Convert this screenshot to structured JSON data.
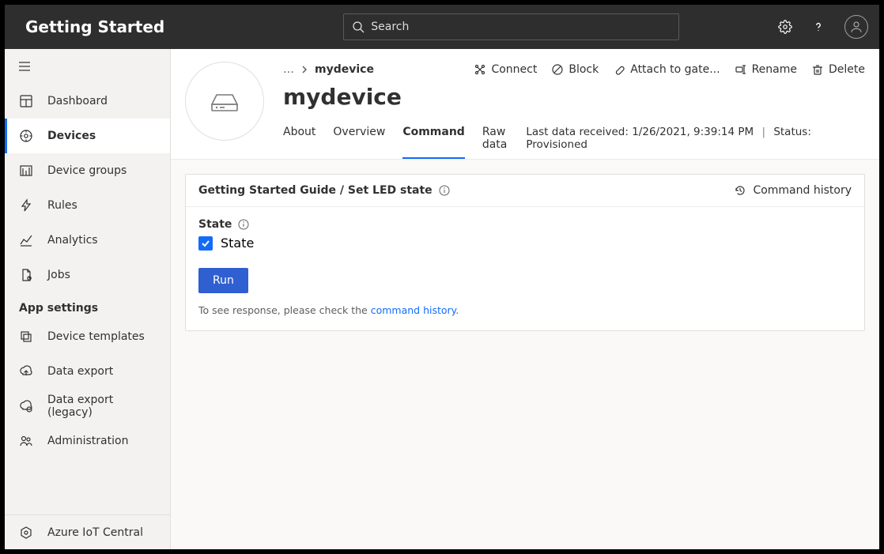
{
  "header": {
    "title": "Getting Started",
    "search_placeholder": "Search"
  },
  "sidebar": {
    "items": [
      {
        "label": "Dashboard"
      },
      {
        "label": "Devices"
      },
      {
        "label": "Device groups"
      },
      {
        "label": "Rules"
      },
      {
        "label": "Analytics"
      },
      {
        "label": "Jobs"
      }
    ],
    "settings_label": "App settings",
    "settings_items": [
      {
        "label": "Device templates"
      },
      {
        "label": "Data export"
      },
      {
        "label": "Data export (legacy)"
      },
      {
        "label": "Administration"
      }
    ],
    "footer_label": "Azure IoT Central"
  },
  "breadcrumb": {
    "ellipsis": "…",
    "current": "mydevice"
  },
  "device": {
    "title": "mydevice",
    "actions": {
      "connect": "Connect",
      "block": "Block",
      "attach": "Attach to gate...",
      "rename": "Rename",
      "delete": "Delete"
    },
    "tabs": [
      {
        "label": "About"
      },
      {
        "label": "Overview"
      },
      {
        "label": "Command"
      },
      {
        "label": "Raw data"
      }
    ],
    "active_tab": "Command",
    "status": {
      "last_data_label": "Last data received:",
      "last_data_value": "1/26/2021, 9:39:14 PM",
      "status_label": "Status:",
      "status_value": "Provisioned"
    }
  },
  "panel": {
    "title": "Getting Started Guide / Set LED state",
    "history_label": "Command history",
    "field_label": "State",
    "checkbox_label": "State",
    "run_label": "Run",
    "hint_prefix": "To see response, please check the ",
    "hint_link": "command history",
    "hint_suffix": "."
  }
}
